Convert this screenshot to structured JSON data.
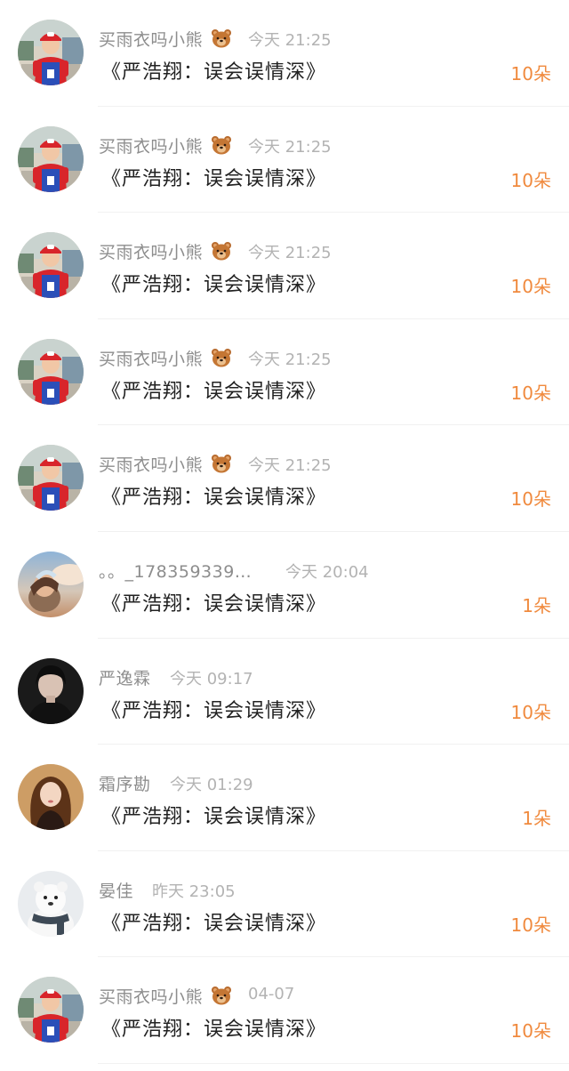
{
  "gift_list": [
    {
      "user": "买雨衣吗小熊",
      "has_bear": true,
      "time": "今天 21:25",
      "message": "《严浩翔：误会误情深》",
      "count": "10朵",
      "avatar": "mario"
    },
    {
      "user": "买雨衣吗小熊",
      "has_bear": true,
      "time": "今天 21:25",
      "message": "《严浩翔：误会误情深》",
      "count": "10朵",
      "avatar": "mario"
    },
    {
      "user": "买雨衣吗小熊",
      "has_bear": true,
      "time": "今天 21:25",
      "message": "《严浩翔：误会误情深》",
      "count": "10朵",
      "avatar": "mario"
    },
    {
      "user": "买雨衣吗小熊",
      "has_bear": true,
      "time": "今天 21:25",
      "message": "《严浩翔：误会误情深》",
      "count": "10朵",
      "avatar": "mario"
    },
    {
      "user": "买雨衣吗小熊",
      "has_bear": true,
      "time": "今天 21:25",
      "message": "《严浩翔：误会误情深》",
      "count": "10朵",
      "avatar": "mario"
    },
    {
      "user": "。。_178359339…",
      "has_bear": false,
      "time": "今天 20:04",
      "message": "《严浩翔：误会误情深》",
      "count": "1朵",
      "avatar": "sky"
    },
    {
      "user": "严逸霖",
      "has_bear": false,
      "time": "今天 09:17",
      "message": "《严浩翔：误会误情深》",
      "count": "10朵",
      "avatar": "dark"
    },
    {
      "user": "霜序勘",
      "has_bear": false,
      "time": "今天 01:29",
      "message": "《严浩翔：误会误情深》",
      "count": "1朵",
      "avatar": "girl"
    },
    {
      "user": "晏佳",
      "has_bear": false,
      "time": "昨天 23:05",
      "message": "《严浩翔：误会误情深》",
      "count": "10朵",
      "avatar": "polar-bear"
    },
    {
      "user": "买雨衣吗小熊",
      "has_bear": true,
      "time": "04-07",
      "message": "《严浩翔：误会误情深》",
      "count": "10朵",
      "avatar": "mario"
    }
  ],
  "colors": {
    "name": "#8d8d8d",
    "time": "#b3b3b3",
    "message": "#222222",
    "count": "#f08a3e",
    "divider": "#f1f1f1"
  },
  "icons": {
    "bear_emoji": "bear-face-icon"
  }
}
